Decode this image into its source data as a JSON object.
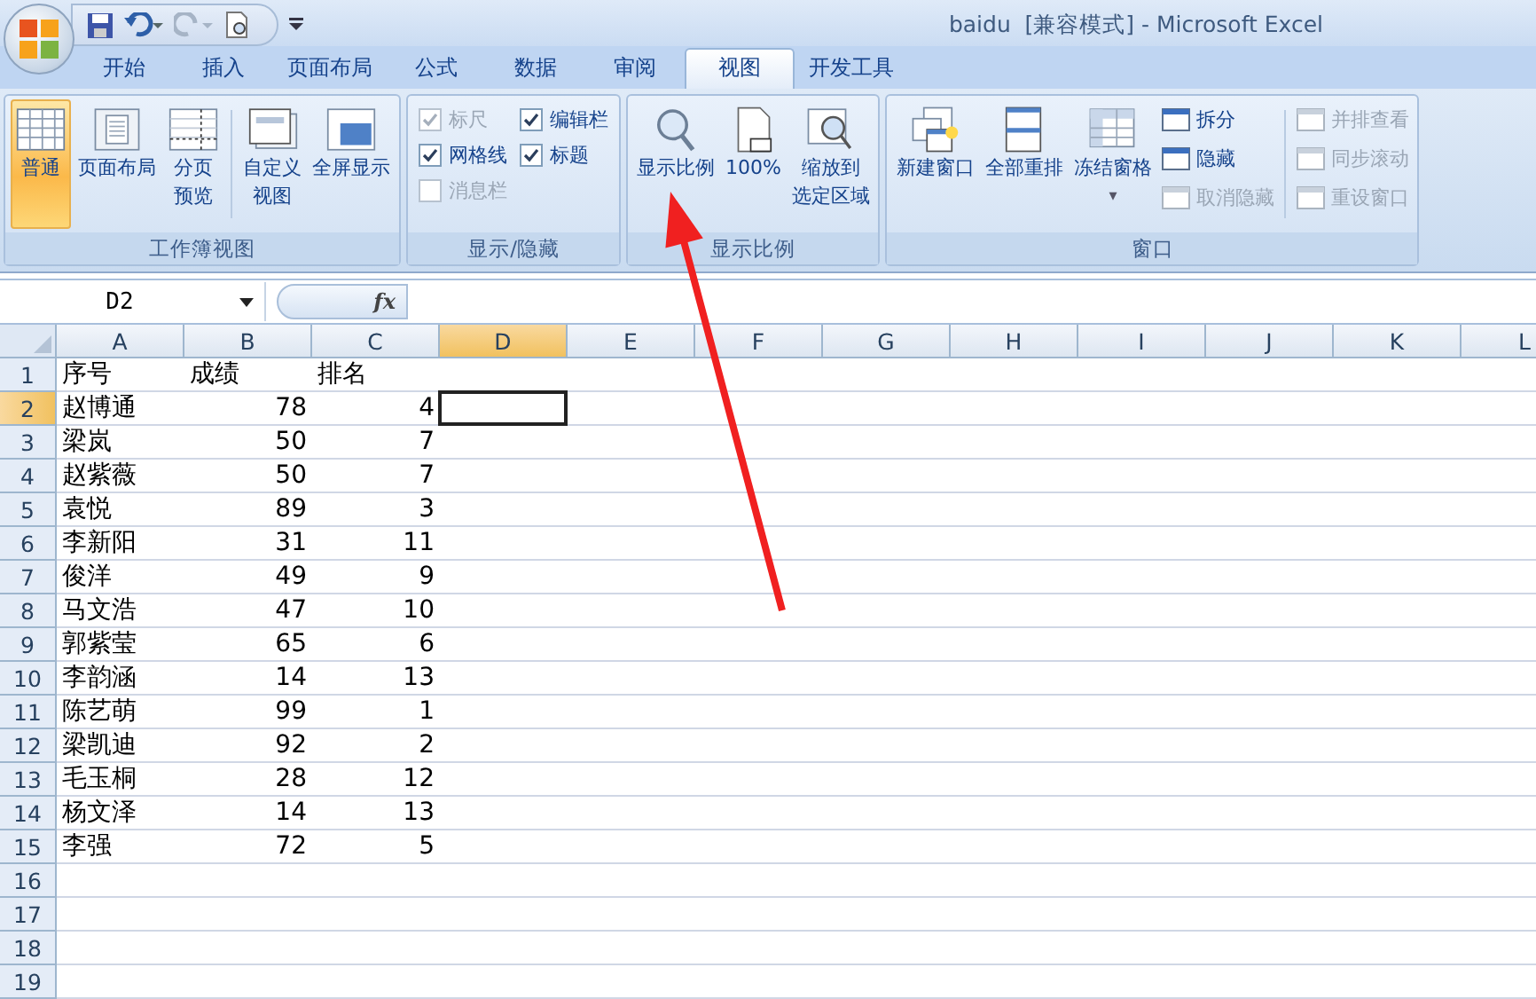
{
  "window": {
    "title": "baidu  [兼容模式] - Microsoft Excel"
  },
  "tabs": [
    {
      "label": "开始",
      "selected": false
    },
    {
      "label": "插入",
      "selected": false
    },
    {
      "label": "页面布局",
      "selected": false
    },
    {
      "label": "公式",
      "selected": false
    },
    {
      "label": "数据",
      "selected": false
    },
    {
      "label": "审阅",
      "selected": false
    },
    {
      "label": "视图",
      "selected": true
    },
    {
      "label": "开发工具",
      "selected": false
    }
  ],
  "ribbon": {
    "groups": [
      {
        "title": "工作簿视图",
        "kind": "buttons",
        "items": [
          {
            "lines": [
              "普通"
            ],
            "selected": true
          },
          {
            "lines": [
              "页面布局"
            ],
            "selected": false
          },
          {
            "lines": [
              "分页",
              "预览"
            ],
            "selected": false
          },
          {
            "lines": [
              "自定义",
              "视图"
            ],
            "selected": false
          },
          {
            "lines": [
              "全屏显示"
            ],
            "selected": false
          }
        ]
      },
      {
        "title": "显示/隐藏",
        "kind": "checks",
        "items": [
          {
            "label": "标尺",
            "checked": true,
            "disabled": true
          },
          {
            "label": "编辑栏",
            "checked": true,
            "disabled": false
          },
          {
            "label": "网格线",
            "checked": true,
            "disabled": false
          },
          {
            "label": "标题",
            "checked": true,
            "disabled": false
          },
          {
            "label": "消息栏",
            "checked": false,
            "disabled": true
          }
        ]
      },
      {
        "title": "显示比例",
        "kind": "buttons",
        "items": [
          {
            "lines": [
              "显示比例"
            ],
            "selected": false
          },
          {
            "lines": [
              "100%"
            ],
            "selected": false
          },
          {
            "lines": [
              "缩放到",
              "选定区域"
            ],
            "selected": false
          }
        ]
      },
      {
        "title": "窗口",
        "kind": "window",
        "items": [
          {
            "lines": [
              "新建窗口"
            ],
            "selected": false
          },
          {
            "lines": [
              "全部重排"
            ],
            "selected": false
          },
          {
            "lines": [
              "冻结窗格"
            ],
            "selected": false,
            "dropdown": "▾"
          }
        ],
        "small": [
          {
            "label": "拆分",
            "disabled": false
          },
          {
            "label": "隐藏",
            "disabled": false
          },
          {
            "label": "取消隐藏",
            "disabled": true
          },
          {
            "label": "并排查看",
            "disabled": true
          },
          {
            "label": "同步滚动",
            "disabled": true
          },
          {
            "label": "重设窗口",
            "disabled": true
          }
        ]
      }
    ]
  },
  "formula_bar": {
    "name_box": "D2",
    "fx": "fx"
  },
  "sheet": {
    "columns": [
      {
        "label": "A",
        "selected": false
      },
      {
        "label": "B",
        "selected": false
      },
      {
        "label": "C",
        "selected": false
      },
      {
        "label": "D",
        "selected": true
      },
      {
        "label": "E",
        "selected": false
      },
      {
        "label": "F",
        "selected": false
      },
      {
        "label": "G",
        "selected": false
      },
      {
        "label": "H",
        "selected": false
      },
      {
        "label": "I",
        "selected": false
      },
      {
        "label": "J",
        "selected": false
      },
      {
        "label": "K",
        "selected": false
      },
      {
        "label": "L",
        "selected": false
      }
    ],
    "rows": [
      {
        "number": "1",
        "selected": false,
        "cells": [
          "序号",
          "成绩",
          "排名"
        ]
      },
      {
        "number": "2",
        "selected": true,
        "cells": [
          "赵博通",
          "78",
          "4"
        ]
      },
      {
        "number": "3",
        "selected": false,
        "cells": [
          "梁岚",
          "50",
          "7"
        ]
      },
      {
        "number": "4",
        "selected": false,
        "cells": [
          "赵紫薇",
          "50",
          "7"
        ]
      },
      {
        "number": "5",
        "selected": false,
        "cells": [
          "袁悦",
          "89",
          "3"
        ]
      },
      {
        "number": "6",
        "selected": false,
        "cells": [
          "李新阳",
          "31",
          "11"
        ]
      },
      {
        "number": "7",
        "selected": false,
        "cells": [
          "俊洋",
          "49",
          "9"
        ]
      },
      {
        "number": "8",
        "selected": false,
        "cells": [
          "马文浩",
          "47",
          "10"
        ]
      },
      {
        "number": "9",
        "selected": false,
        "cells": [
          "郭紫莹",
          "65",
          "6"
        ]
      },
      {
        "number": "10",
        "selected": false,
        "cells": [
          "李韵涵",
          "14",
          "13"
        ]
      },
      {
        "number": "11",
        "selected": false,
        "cells": [
          "陈艺萌",
          "99",
          "1"
        ]
      },
      {
        "number": "12",
        "selected": false,
        "cells": [
          "梁凯迪",
          "92",
          "2"
        ]
      },
      {
        "number": "13",
        "selected": false,
        "cells": [
          "毛玉桐",
          "28",
          "12"
        ]
      },
      {
        "number": "14",
        "selected": false,
        "cells": [
          "杨文泽",
          "14",
          "13"
        ]
      },
      {
        "number": "15",
        "selected": false,
        "cells": [
          "李强",
          "72",
          "5"
        ]
      },
      {
        "number": "16",
        "selected": false,
        "cells": []
      },
      {
        "number": "17",
        "selected": false,
        "cells": []
      },
      {
        "number": "18",
        "selected": false,
        "cells": []
      },
      {
        "number": "19",
        "selected": false,
        "cells": []
      }
    ]
  }
}
